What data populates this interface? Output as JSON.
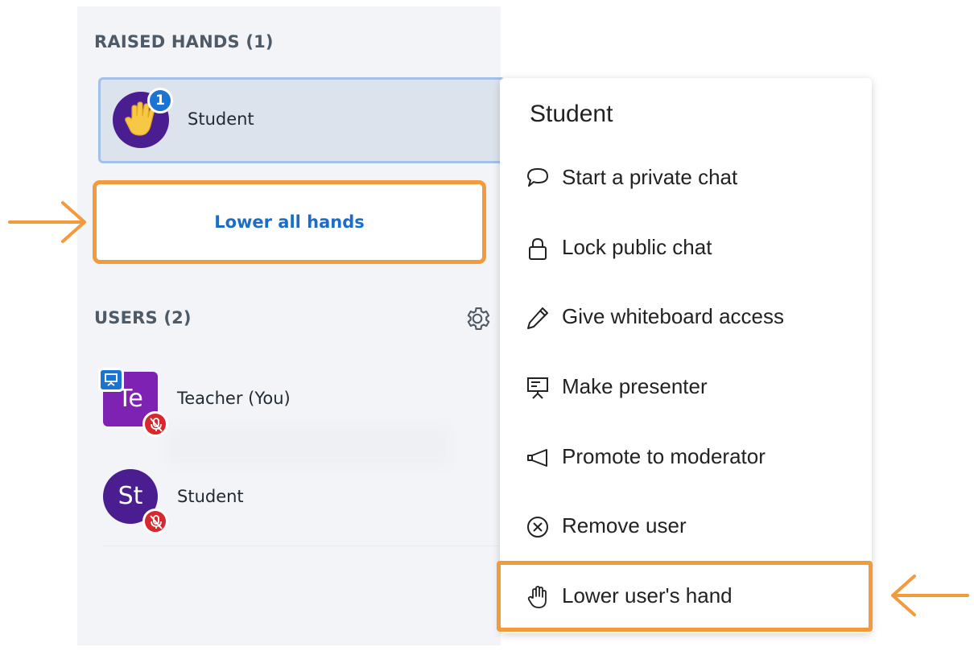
{
  "raised_hands": {
    "title": "RAISED HANDS (1)",
    "badge_count": "1",
    "user_name": "Student",
    "lower_all_label": "Lower all hands"
  },
  "users": {
    "title": "USERS (2)",
    "list": [
      {
        "initials": "Te",
        "name": "Teacher (You)",
        "presenter": true,
        "muted": true,
        "avatar_color": "#7e22b3"
      },
      {
        "initials": "St",
        "name": "Student",
        "presenter": false,
        "muted": true,
        "avatar_color": "#4a1d91"
      }
    ]
  },
  "context_menu": {
    "title": "Student",
    "items": [
      {
        "icon": "chat-bubble-icon",
        "label": "Start a private chat"
      },
      {
        "icon": "lock-icon",
        "label": "Lock public chat"
      },
      {
        "icon": "pencil-icon",
        "label": "Give whiteboard access"
      },
      {
        "icon": "presenter-icon",
        "label": "Make presenter"
      },
      {
        "icon": "megaphone-icon",
        "label": "Promote to moderator"
      },
      {
        "icon": "remove-circle-icon",
        "label": "Remove user"
      },
      {
        "icon": "hand-icon",
        "label": "Lower user's hand"
      }
    ]
  },
  "colors": {
    "highlight_orange": "#f39a3c",
    "link_blue": "#1b6dc9",
    "badge_blue": "#1b74d3",
    "mute_red": "#d7282f"
  }
}
